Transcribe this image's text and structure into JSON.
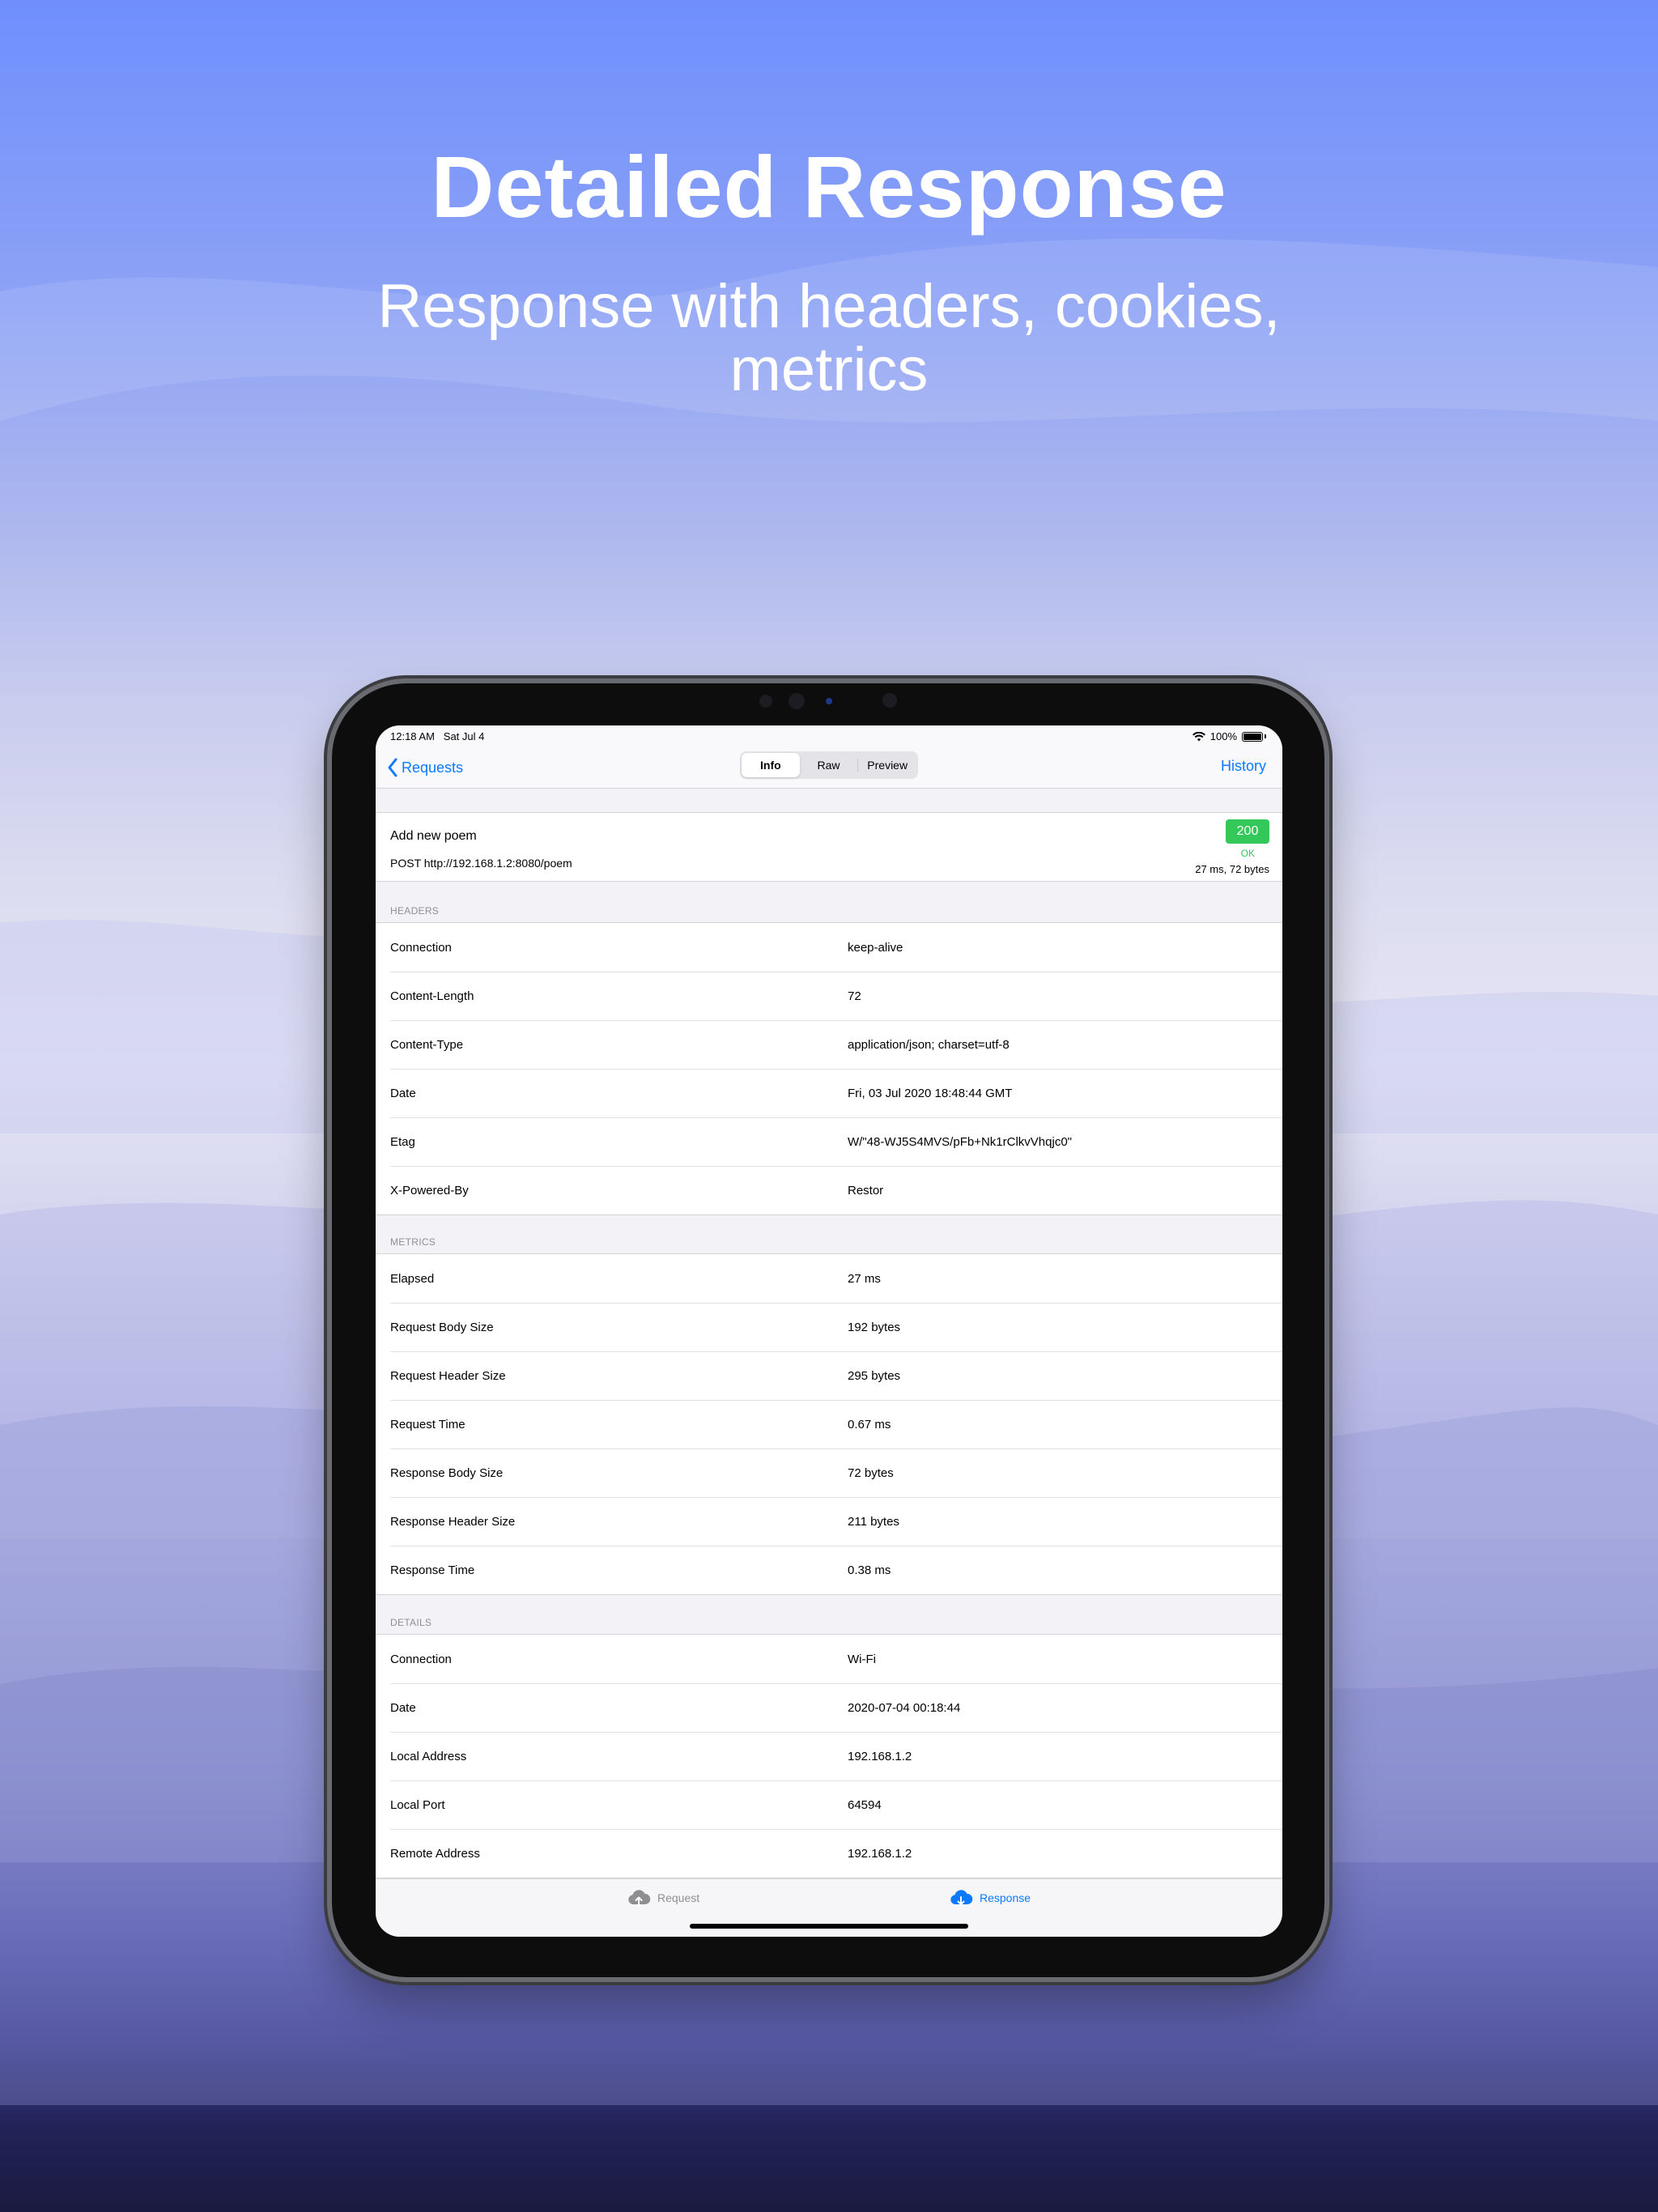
{
  "promo": {
    "title": "Detailed Response",
    "subtitle": "Response with headers, cookies, metrics"
  },
  "status_bar": {
    "time": "12:18 AM",
    "date": "Sat Jul 4",
    "battery": "100%"
  },
  "nav": {
    "back_label": "Requests",
    "history_label": "History",
    "segments": [
      "Info",
      "Raw",
      "Preview"
    ],
    "active_segment": "Info"
  },
  "summary": {
    "name": "Add new poem",
    "method_url": "POST http://192.168.1.2:8080/poem",
    "status_code": "200",
    "status_text": "OK",
    "meta": "27 ms, 72 bytes"
  },
  "headers": {
    "label": "HEADERS",
    "rows": [
      {
        "key": "Connection",
        "value": "keep-alive"
      },
      {
        "key": "Content-Length",
        "value": "72"
      },
      {
        "key": "Content-Type",
        "value": "application/json; charset=utf-8"
      },
      {
        "key": "Date",
        "value": "Fri, 03 Jul 2020 18:48:44 GMT"
      },
      {
        "key": "Etag",
        "value": "W/\"48-WJ5S4MVS/pFb+Nk1rClkvVhqjc0\""
      },
      {
        "key": "X-Powered-By",
        "value": "Restor"
      }
    ]
  },
  "metrics": {
    "label": "METRICS",
    "rows": [
      {
        "key": "Elapsed",
        "value": "27 ms"
      },
      {
        "key": "Request Body Size",
        "value": "192 bytes"
      },
      {
        "key": "Request Header Size",
        "value": "295 bytes"
      },
      {
        "key": "Request Time",
        "value": "0.67 ms"
      },
      {
        "key": "Response Body Size",
        "value": "72 bytes"
      },
      {
        "key": "Response Header Size",
        "value": "211 bytes"
      },
      {
        "key": "Response Time",
        "value": "0.38 ms"
      }
    ]
  },
  "details": {
    "label": "DETAILS",
    "rows": [
      {
        "key": "Connection",
        "value": "Wi-Fi"
      },
      {
        "key": "Date",
        "value": "2020-07-04 00:18:44"
      },
      {
        "key": "Local Address",
        "value": "192.168.1.2"
      },
      {
        "key": "Local Port",
        "value": "64594"
      },
      {
        "key": "Remote Address",
        "value": "192.168.1.2"
      }
    ]
  },
  "tabs": {
    "request_label": "Request",
    "response_label": "Response",
    "active": "Response"
  },
  "colors": {
    "accent": "#0a7aff",
    "success": "#34c759",
    "secondary_text": "#8e8e93"
  }
}
